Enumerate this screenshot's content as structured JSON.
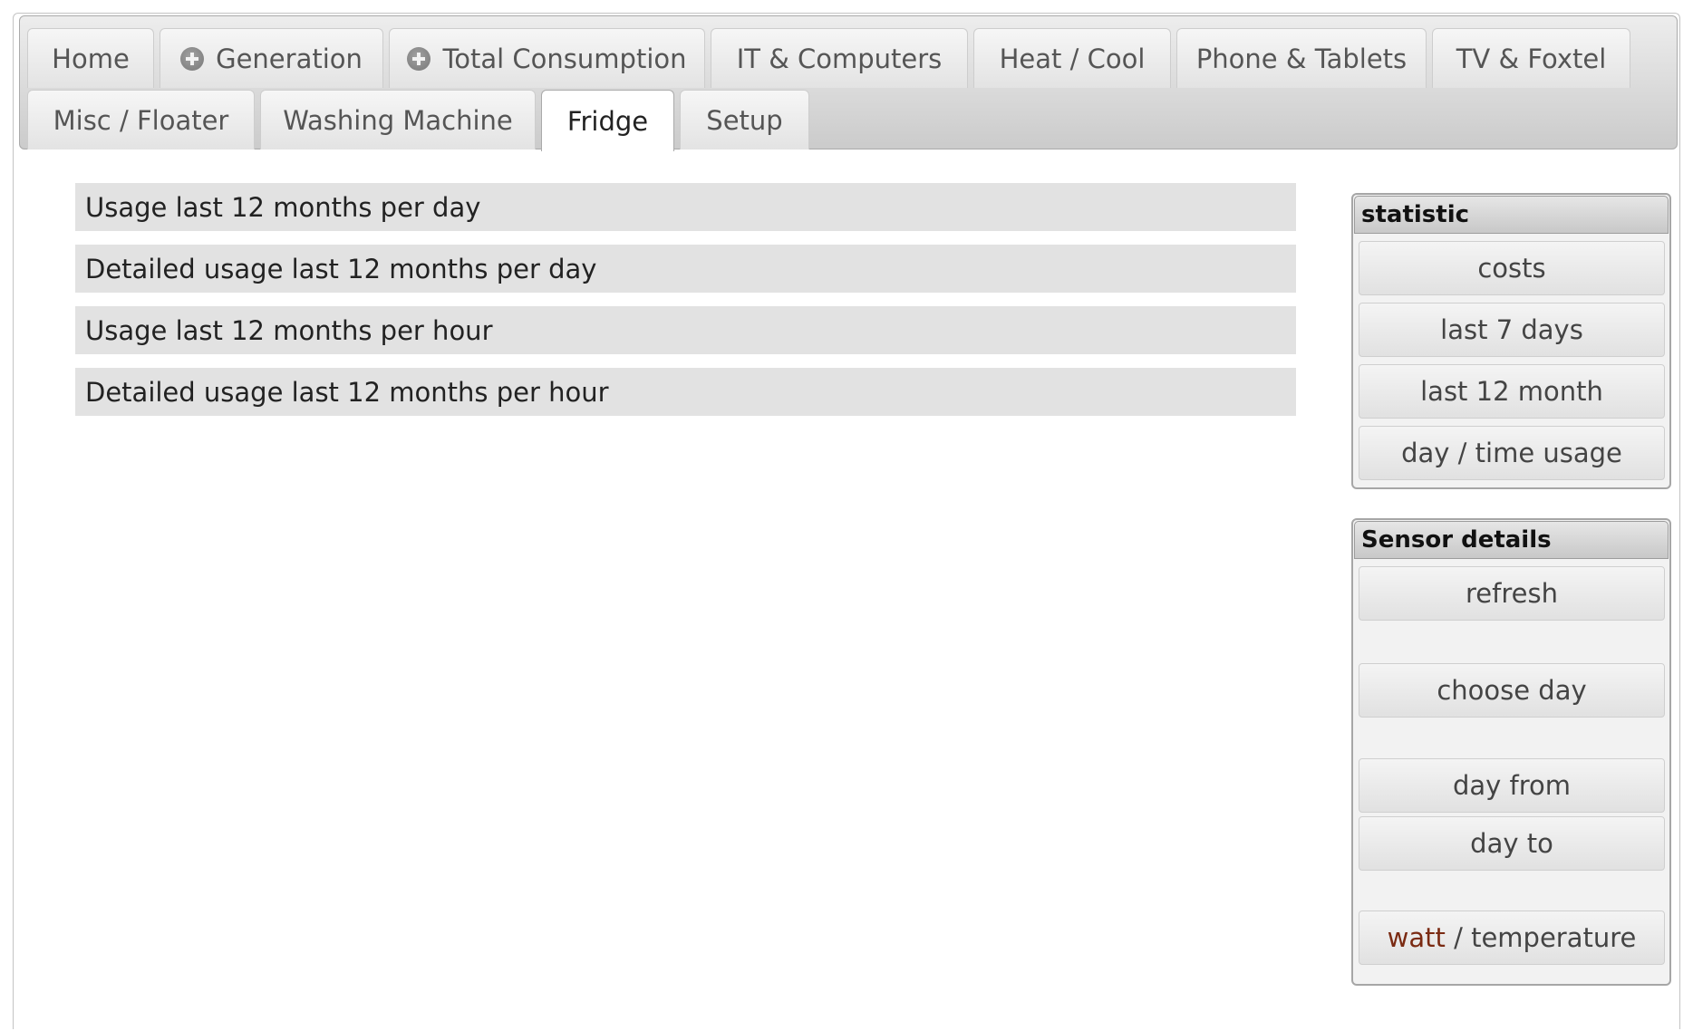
{
  "tabs": [
    {
      "label": "Home"
    },
    {
      "label": "Generation",
      "icon": "plus-circle-icon"
    },
    {
      "label": "Total Consumption",
      "icon": "plus-circle-icon"
    },
    {
      "label": "IT & Computers"
    },
    {
      "label": "Heat / Cool"
    },
    {
      "label": "Phone & Tablets"
    },
    {
      "label": "TV & Foxtel"
    },
    {
      "label": "Misc / Floater"
    },
    {
      "label": "Washing Machine"
    },
    {
      "label": "Fridge",
      "active": true
    },
    {
      "label": "Setup"
    }
  ],
  "content": {
    "items": [
      "Usage last 12 months per day",
      "Detailed usage last 12 months per day",
      "Usage last 12 months per hour",
      "Detailed usage last 12 months per hour"
    ]
  },
  "statistic_panel": {
    "title": "statistic",
    "buttons": [
      "costs",
      "last 7 days",
      "last 12 month",
      "day / time usage"
    ]
  },
  "sensor_panel": {
    "title": "Sensor details",
    "buttons": {
      "refresh": "refresh",
      "choose_day": "choose day",
      "day_from": "day from",
      "day_to": "day to",
      "watt": "watt",
      "separator": " / ",
      "temperature": "temperature"
    }
  },
  "colors": {
    "accent_watt": "#7a2a12",
    "row_background": "#e2e2e2",
    "tabbar_gradient": [
      "#ededed",
      "#cbcbcb"
    ]
  }
}
